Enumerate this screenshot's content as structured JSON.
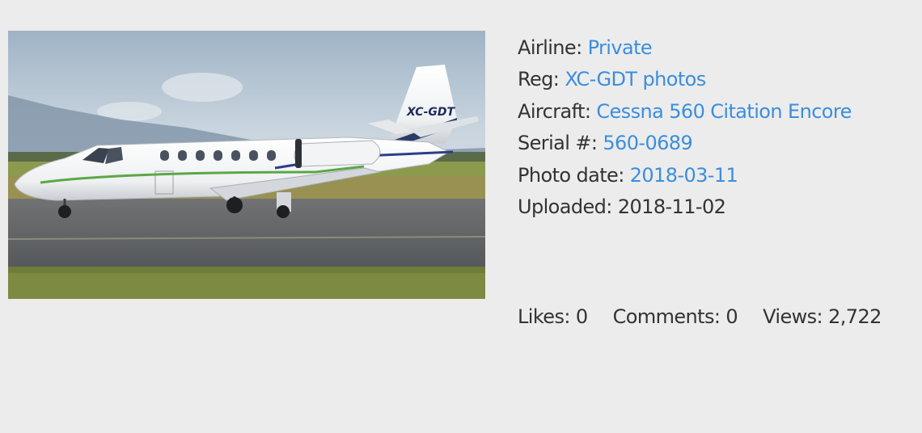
{
  "photo": {
    "alt": "Cessna 560 Citation Encore XC-GDT",
    "tail_marking": "XC-GDT"
  },
  "details": {
    "airline_label": "Airline:",
    "airline_value": "Private",
    "reg_label": "Reg:",
    "reg_value": "XC-GDT photos",
    "aircraft_label": "Aircraft:",
    "aircraft_value": "Cessna 560 Citation Encore",
    "serial_label": "Serial #:",
    "serial_value": "560-0689",
    "photo_date_label": "Photo date:",
    "photo_date_value": "2018-03-11",
    "uploaded_label": "Uploaded:",
    "uploaded_value": "2018-11-02"
  },
  "stats": {
    "likes_label": "Likes:",
    "likes_value": "0",
    "comments_label": "Comments:",
    "comments_value": "0",
    "views_label": "Views:",
    "views_value": "2,722"
  },
  "colors": {
    "background": "#ececec",
    "text": "#333333",
    "link": "#3b8ede"
  }
}
